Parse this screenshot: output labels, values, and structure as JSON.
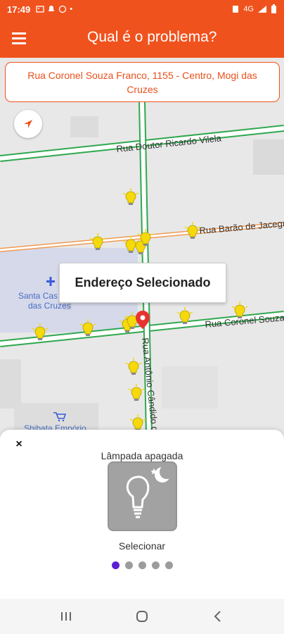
{
  "status_bar": {
    "time": "17:49",
    "network": "4G",
    "battery_icon": "battery-icon",
    "signal_icon": "signal-icon"
  },
  "app_bar": {
    "title": "Qual é o problema?",
    "menu_icon": "hamburger-menu-icon"
  },
  "address": {
    "text": "Rua Coronel Souza Franco, 1155 - Centro, Mogi das Cruzes"
  },
  "map": {
    "streets": [
      "Rua Doutor Ricardo Vilela",
      "Rua Barão de Jaceguai",
      "Rua Coronel Souza",
      "Rua Antônio Cândido de M"
    ],
    "places": [
      {
        "name": "Santa Casa das Cruzes",
        "line1": "Santa Cas",
        "line2": "das Cruzes"
      },
      {
        "name": "Shibata Empório",
        "line1": "Shibata Empório"
      }
    ],
    "tooltip": "Endereço Selecionado",
    "locate_icon": "navigation-arrow-icon",
    "pin_icon": "location-pin-icon",
    "bulb_icon": "light-bulb-icon",
    "colors": {
      "accent": "#f0521e",
      "green_road": "#2fa84f",
      "orange_road": "#f19a52",
      "bulb": "#f5d90a"
    }
  },
  "bottom_sheet": {
    "close_label": "×",
    "option_title": "Lâmpada apagada",
    "option_icon": "light-bulb-off-icon",
    "select_label": "Selecionar",
    "dots_count": 5,
    "active_dot": 0,
    "active_color": "#5b1fd6"
  },
  "nav_bar": {
    "recent": "recent-apps-icon",
    "home": "home-icon",
    "back": "back-icon"
  }
}
